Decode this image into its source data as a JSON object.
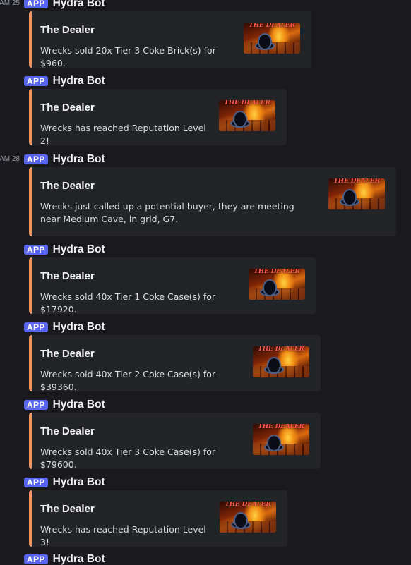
{
  "messages": [
    {
      "time": "25 AM",
      "badge": "APP",
      "username": "Hydra Bot",
      "embed": {
        "title": "The Dealer",
        "description": "Wrecks sold 20x Tier 3 Coke Brick(s) for $960.",
        "thumbnail": {
          "label": "THE DEALER"
        }
      }
    },
    {
      "time": "",
      "badge": "APP",
      "username": "Hydra Bot",
      "embed": {
        "title": "The Dealer",
        "description": "Wrecks has reached Reputation Level 2!",
        "thumbnail": {
          "label": "THE DEALER"
        }
      }
    },
    {
      "time": "28 AM",
      "badge": "APP",
      "username": "Hydra Bot",
      "embed": {
        "title": "The Dealer",
        "description": "Wrecks just called up a potential buyer, they are meeting near Medium Cave, in grid, G7.",
        "thumbnail": {
          "label": "THE DEALER"
        }
      }
    },
    {
      "time": "",
      "badge": "APP",
      "username": "Hydra Bot",
      "embed": {
        "title": "The Dealer",
        "description": "Wrecks sold 40x Tier 1 Coke Case(s) for $17920.",
        "thumbnail": {
          "label": "THE DEALER"
        }
      }
    },
    {
      "time": "",
      "badge": "APP",
      "username": "Hydra Bot",
      "embed": {
        "title": "The Dealer",
        "description": "Wrecks sold 40x Tier 2 Coke Case(s) for $39360.",
        "thumbnail": {
          "label": "THE DEALER"
        }
      }
    },
    {
      "time": "",
      "badge": "APP",
      "username": "Hydra Bot",
      "embed": {
        "title": "The Dealer",
        "description": "Wrecks sold 40x Tier 3 Coke Case(s) for $79600.",
        "thumbnail": {
          "label": "THE DEALER"
        }
      }
    },
    {
      "time": "",
      "badge": "APP",
      "username": "Hydra Bot",
      "embed": {
        "title": "The Dealer",
        "description": "Wrecks has reached Reputation Level 3!",
        "thumbnail": {
          "label": "THE DEALER"
        }
      }
    },
    {
      "time": "",
      "badge": "APP",
      "username": "Hydra Bot",
      "embed": null
    }
  ],
  "colors": {
    "background": "#1a1a1e",
    "embed_background": "#232428",
    "embed_accent": "#f0955f",
    "app_badge": "#5865f2"
  }
}
